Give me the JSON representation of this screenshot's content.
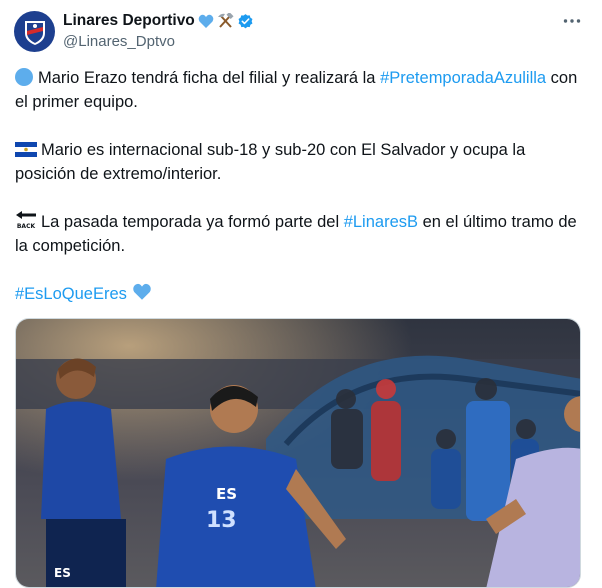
{
  "tweet": {
    "author_name": "Linares Deportivo",
    "author_handle": "@Linares_Dptvo",
    "name_emojis": [
      "💙",
      "⚒️"
    ],
    "verified": true,
    "paragraph1": {
      "pre": "Mario Erazo tendrá ficha del filial y realizará la ",
      "hashtag": "#PretemporadaAzulilla",
      "post": " con el primer equipo."
    },
    "paragraph2": {
      "text": "Mario es internacional sub-18 y sub-20 con El Salvador y ocupa la posición de extremo/interior."
    },
    "paragraph3": {
      "pre": "La pasada temporada ya formó parte del ",
      "hashtag": "#LinaresB",
      "post": " en el último tramo de la competición."
    },
    "paragraph4": {
      "hashtag": "#EsLoQueEres",
      "emoji": "💙"
    },
    "icons": {
      "bullet": "blue-circle-icon",
      "flag": "el-salvador-flag-icon",
      "back": "back-arrow-icon",
      "verified": "verified-badge-icon",
      "more": "more-options-icon"
    },
    "jersey_labels": [
      "ES",
      "13",
      "ES"
    ],
    "colors": {
      "hashtag": "#1d9bf0",
      "handle": "#536471",
      "verified": "#1d9bf0",
      "heart": "#5dadec"
    }
  }
}
